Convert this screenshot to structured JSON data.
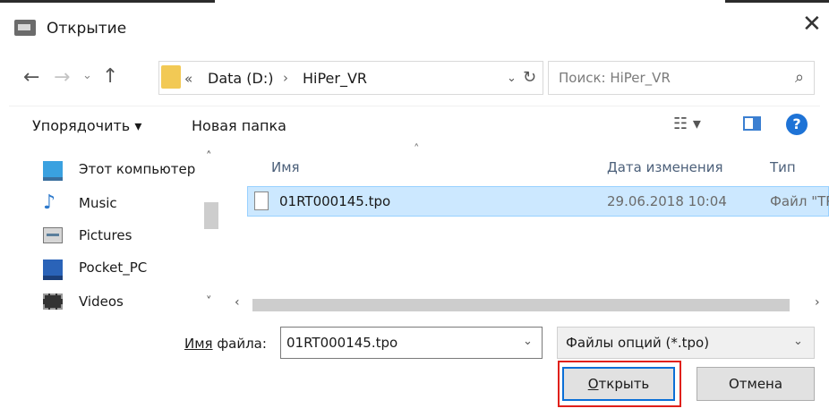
{
  "window": {
    "title": "Открытие",
    "close_glyph": "✕"
  },
  "nav": {
    "back": "←",
    "forward": "→",
    "recent": "⌄",
    "up": "↑"
  },
  "address": {
    "chevrons": "«",
    "segments": [
      "Data (D:)",
      "HiPer_VR"
    ],
    "separator": "›",
    "dropdown": "⌄",
    "refresh": "↻"
  },
  "search": {
    "placeholder": "Поиск: HiPer_VR",
    "icon": "search-icon"
  },
  "toolbar": {
    "organize": "Упорядочить ▾",
    "new_folder": "Новая папка",
    "views": "☷ ▾",
    "help": "?"
  },
  "sidebar": {
    "items": [
      {
        "label": "Этот компьютер",
        "icon": "computer-icon"
      },
      {
        "label": "Music",
        "icon": "music-icon"
      },
      {
        "label": "Pictures",
        "icon": "pictures-icon"
      },
      {
        "label": "Pocket_PC",
        "icon": "device-icon"
      },
      {
        "label": "Videos",
        "icon": "videos-icon"
      }
    ],
    "scroll_up": "˄",
    "scroll_down": "˅"
  },
  "file_list": {
    "columns": {
      "name": "Имя",
      "date": "Дата изменения",
      "type": "Тип"
    },
    "sort_caret": "˄",
    "rows": [
      {
        "name": "01RT000145.tpo",
        "date": "29.06.2018 10:04",
        "type": "Файл \"TPO\""
      }
    ],
    "scroll_left": "‹",
    "scroll_right": "›"
  },
  "footer": {
    "filename_label_prefix": "Имя",
    "filename_label_rest": " файла:",
    "filename_value": "01RT000145.tpo",
    "filetype_value": "Файлы опций (*.tpo)",
    "dropdown": "⌄",
    "open_hotkey": "О",
    "open_rest": "ткрыть",
    "cancel": "Отмена"
  },
  "colors": {
    "highlight": "#cce8ff",
    "accent": "#0a6fd6",
    "callout": "#e0201b"
  }
}
